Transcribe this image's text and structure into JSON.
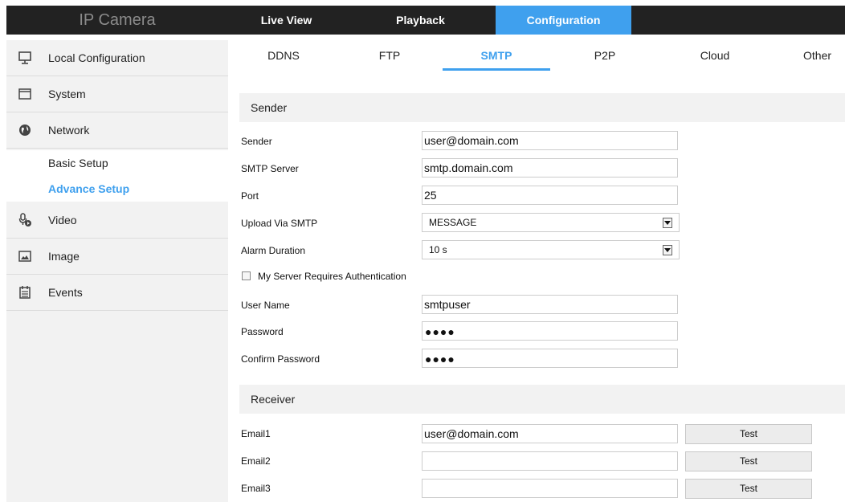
{
  "app": {
    "title": "IP Camera"
  },
  "nav": {
    "tabs": [
      {
        "label": "Live View"
      },
      {
        "label": "Playback"
      },
      {
        "label": "Configuration"
      }
    ]
  },
  "sidebar": {
    "items": [
      {
        "label": "Local Configuration",
        "icon": "monitor-icon"
      },
      {
        "label": "System",
        "icon": "window-icon"
      },
      {
        "label": "Network",
        "icon": "globe-icon"
      },
      {
        "label": "Video",
        "icon": "microphone-icon"
      },
      {
        "label": "Image",
        "icon": "image-icon"
      },
      {
        "label": "Events",
        "icon": "calendar-icon"
      }
    ],
    "subitems": [
      {
        "label": "Basic Setup"
      },
      {
        "label": "Advance Setup"
      }
    ]
  },
  "subnav": {
    "tabs": [
      {
        "label": "DDNS"
      },
      {
        "label": "FTP"
      },
      {
        "label": "SMTP"
      },
      {
        "label": "P2P"
      },
      {
        "label": "Cloud"
      },
      {
        "label": "Other"
      }
    ]
  },
  "sender": {
    "section_title": "Sender",
    "sender_label": "Sender",
    "sender_value": "user@domain.com",
    "server_label": "SMTP Server",
    "server_value": "smtp.domain.com",
    "port_label": "Port",
    "port_value": "25",
    "upload_label": "Upload Via SMTP",
    "upload_value": "MESSAGE",
    "duration_label": "Alarm Duration",
    "duration_value": "10 s",
    "auth_label": "My Server Requires Authentication",
    "username_label": "User Name",
    "username_value": "smtpuser",
    "password_label": "Password",
    "password_mask": "●●●●",
    "confirm_label": "Confirm Password",
    "confirm_mask": "●●●●"
  },
  "receiver": {
    "section_title": "Receiver",
    "emails": [
      {
        "label": "Email1",
        "value": "user@domain.com"
      },
      {
        "label": "Email2",
        "value": ""
      },
      {
        "label": "Email3",
        "value": ""
      }
    ],
    "test_label": "Test"
  },
  "colors": {
    "accent": "#3fa0ee",
    "topbar": "#222222",
    "sidebar": "#f2f2f2"
  }
}
